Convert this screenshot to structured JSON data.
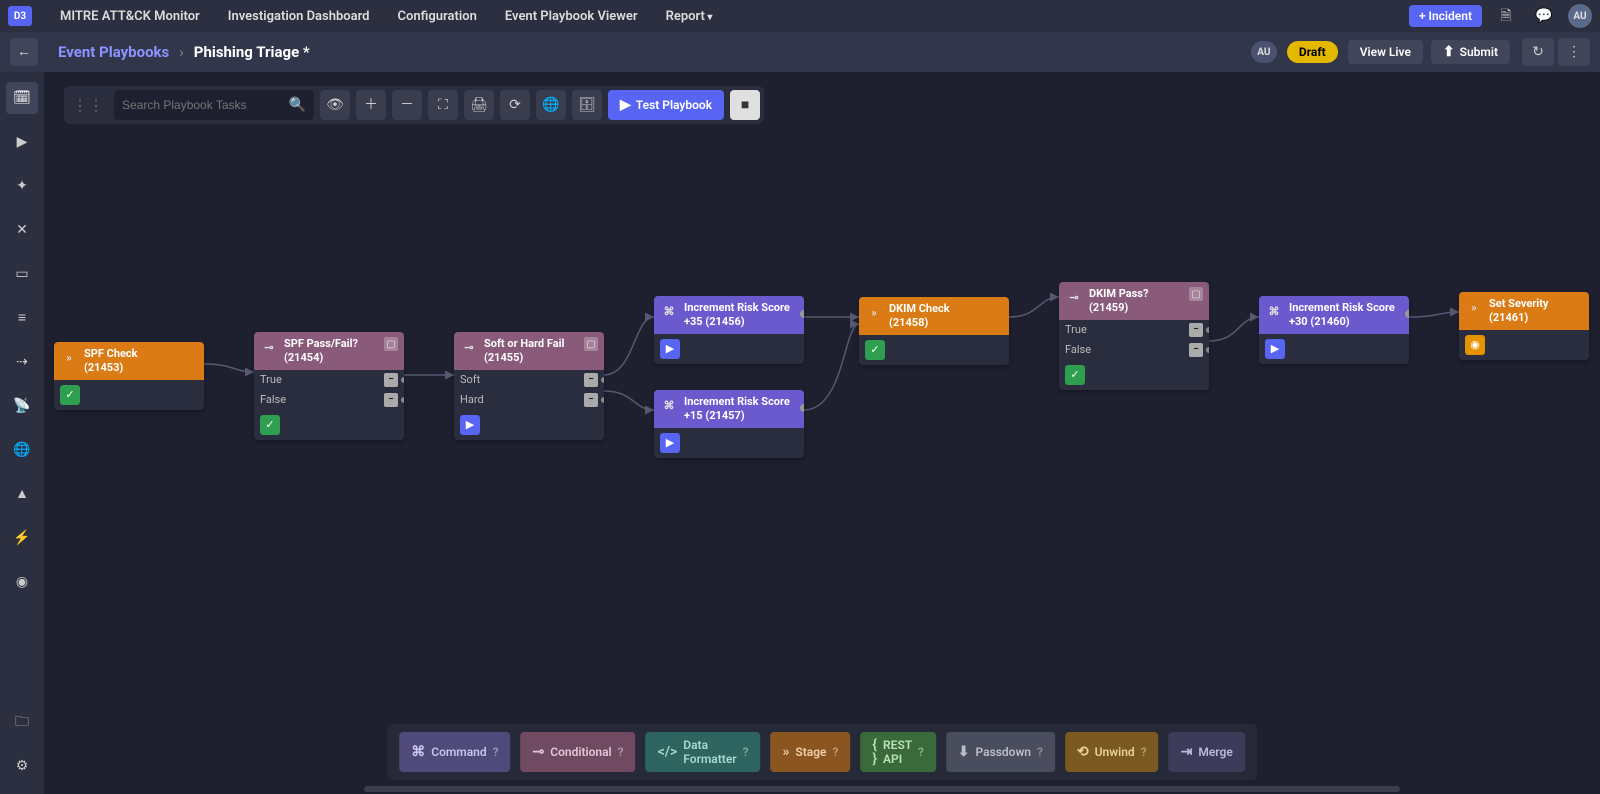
{
  "topnav": {
    "logo": "D3",
    "items": [
      "MITRE ATT&CK Monitor",
      "Investigation Dashboard",
      "Configuration",
      "Event Playbook Viewer",
      "Report"
    ],
    "incident_btn": "+ Incident",
    "avatar": "AU"
  },
  "subnav": {
    "breadcrumb_link": "Event Playbooks",
    "breadcrumb_current": "Phishing Triage *",
    "chip": "AU",
    "draft": "Draft",
    "view_live": "View Live",
    "submit": "Submit"
  },
  "toolbar": {
    "search_placeholder": "Search Playbook Tasks",
    "test_label": "Test Playbook"
  },
  "nodes": {
    "spf_check": {
      "title": "SPF Check",
      "id": "(21453)"
    },
    "spf_pass": {
      "title": "SPF Pass/Fail?",
      "id": "(21454)",
      "rows": [
        "True",
        "False"
      ]
    },
    "soft_hard": {
      "title": "Soft or Hard Fail",
      "id": "(21455)",
      "rows": [
        "Soft",
        "Hard"
      ]
    },
    "inc35": {
      "title": "Increment Risk Score +35",
      "id": "(21456)"
    },
    "inc15": {
      "title": "Increment Risk Score +15",
      "id": "(21457)"
    },
    "dkim": {
      "title": "DKIM Check",
      "id": "(21458)"
    },
    "dkim_pass": {
      "title": "DKIM Pass?",
      "id": "(21459)",
      "rows": [
        "True",
        "False"
      ]
    },
    "inc30": {
      "title": "Increment Risk Score +30",
      "id": "(21460)"
    },
    "set_sev": {
      "title": "Set Severity",
      "id": "(21461)"
    }
  },
  "palette": {
    "command": "Command",
    "cond": "Conditional",
    "data": "Data Formatter",
    "stage": "Stage",
    "rest": "REST API",
    "pass": "Passdown",
    "unwind": "Unwind",
    "merge": "Merge"
  }
}
